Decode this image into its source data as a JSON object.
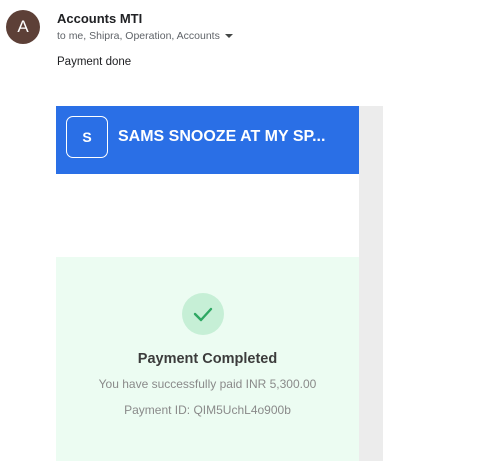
{
  "email": {
    "avatar_letter": "A",
    "sender": "Accounts MTI",
    "recipients_prefix": "to ",
    "recipients": "me, Shipra, Operation, Accounts",
    "body": "Payment done"
  },
  "payment_card": {
    "merchant_initial": "S",
    "merchant_name": "SAMS SNOOZE AT MY SP...",
    "header_color": "#2a6fe6",
    "status_title": "Payment Completed",
    "amount_text": "You have successfully paid INR 5,300.00",
    "payment_id_text": "Payment ID: QIM5UchL4o900b",
    "success_color": "#2ea863",
    "icon": "check-icon"
  }
}
